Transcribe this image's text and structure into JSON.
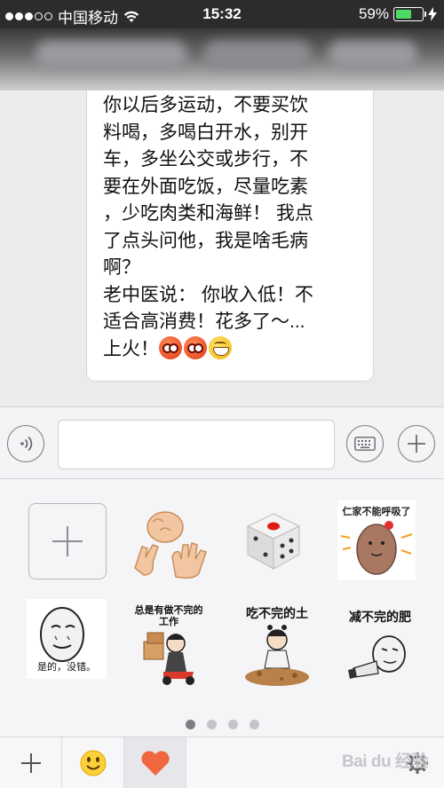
{
  "status_bar": {
    "carrier": "中国移动",
    "time": "15:32",
    "battery_percent": "59%",
    "battery_level": 0.59,
    "signal_bars_filled": 3,
    "signal_bars_total": 5
  },
  "chat": {
    "message_lines": [
      "你以后多运动，不要买饮",
      "料喝，多喝白开水，别开",
      "车，多坐公交或步行，不",
      "要在外面吃饭，尽量吃素",
      "，少吃肉类和海鲜！ 我点",
      "了点头问他，我是啥毛病",
      "啊？",
      "老中医说： 你收入低！不",
      "适合高消费！花多了～...",
      "上火！"
    ]
  },
  "input_bar": {
    "voice_icon": "voice-icon",
    "text_value": "",
    "keyboard_icon": "keyboard-icon",
    "plus_icon": "plus-icon"
  },
  "stickers": {
    "row1": {
      "add": "add-sticker-icon",
      "rps": "rock-paper-scissors-icon",
      "dice": "dice-icon",
      "bean_caption": "仁家不能呼吸了"
    },
    "row2": {
      "face_caption": "是的，没错。",
      "work_caption_line1": "总是有做不完的",
      "work_caption_line2": "工作",
      "earth_caption": "吃不完的土",
      "fat_caption": "减不完的肥"
    },
    "pages_total": 4,
    "page_active": 1
  },
  "toolbar": {
    "plus_label": "+",
    "watermark": "Bai du 经验"
  },
  "colors": {
    "status_bar_bg": "#2c2c2c",
    "battery_green": "#4cd964",
    "heart_red": "#f0663e"
  }
}
